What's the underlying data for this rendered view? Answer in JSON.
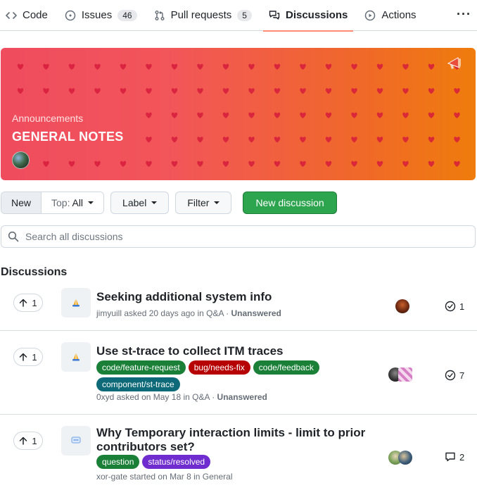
{
  "tabs": [
    {
      "label": "Code",
      "icon": "code-icon"
    },
    {
      "label": "Issues",
      "icon": "issue-opened-icon",
      "count": "46"
    },
    {
      "label": "Pull requests",
      "icon": "git-pull-request-icon",
      "count": "5"
    },
    {
      "label": "Discussions",
      "icon": "comment-discussion-icon",
      "active": true
    },
    {
      "label": "Actions",
      "icon": "play-icon"
    }
  ],
  "more_label": "···",
  "banner": {
    "subtitle": "Announcements",
    "title": "GENERAL NOTES",
    "colors": {
      "start": "#ef4c5e",
      "end": "#ef7c0c",
      "heart": "#d61c3c"
    }
  },
  "toolbar": {
    "new_label": "New",
    "top_prefix": "Top:",
    "top_value": "All",
    "label_label": "Label",
    "filter_label": "Filter",
    "new_discussion_label": "New discussion"
  },
  "search": {
    "placeholder": "Search all discussions"
  },
  "section_title": "Discussions",
  "discussions": [
    {
      "votes": "1",
      "category_icon": "pray-hands-icon",
      "title": "Seeking additional system info",
      "author": "jimyuill",
      "verb": "asked",
      "when": "20 days ago",
      "category": "Q&A",
      "status": "Unanswered",
      "labels": [],
      "stat_icon": "check-circle-icon",
      "stat": "1"
    },
    {
      "votes": "1",
      "category_icon": "pray-hands-icon",
      "title": "Use st-trace to collect ITM traces",
      "author": "0xyd",
      "verb": "asked",
      "when": "on May 18",
      "category": "Q&A",
      "status": "Unanswered",
      "labels": [
        {
          "name": "code/feature-request",
          "color": "#1a7f37"
        },
        {
          "name": "bug/needs-fix",
          "color": "#b60205"
        },
        {
          "name": "code/feedback",
          "color": "#1a7f37"
        },
        {
          "name": "component/st-trace",
          "color": "#0e6a78"
        }
      ],
      "stat_icon": "check-circle-icon",
      "stat": "7"
    },
    {
      "votes": "1",
      "category_icon": "speech-bubble-icon",
      "title": "Why Temporary interaction limits - limit to prior contributors set?",
      "author": "xor-gate",
      "verb": "started",
      "when": "on Mar 8",
      "category": "General",
      "status": "",
      "labels": [
        {
          "name": "question",
          "color": "#1a7f37"
        },
        {
          "name": "status/resolved",
          "color": "#6f2ccf"
        }
      ],
      "stat_icon": "comment-icon",
      "stat": "2"
    }
  ]
}
